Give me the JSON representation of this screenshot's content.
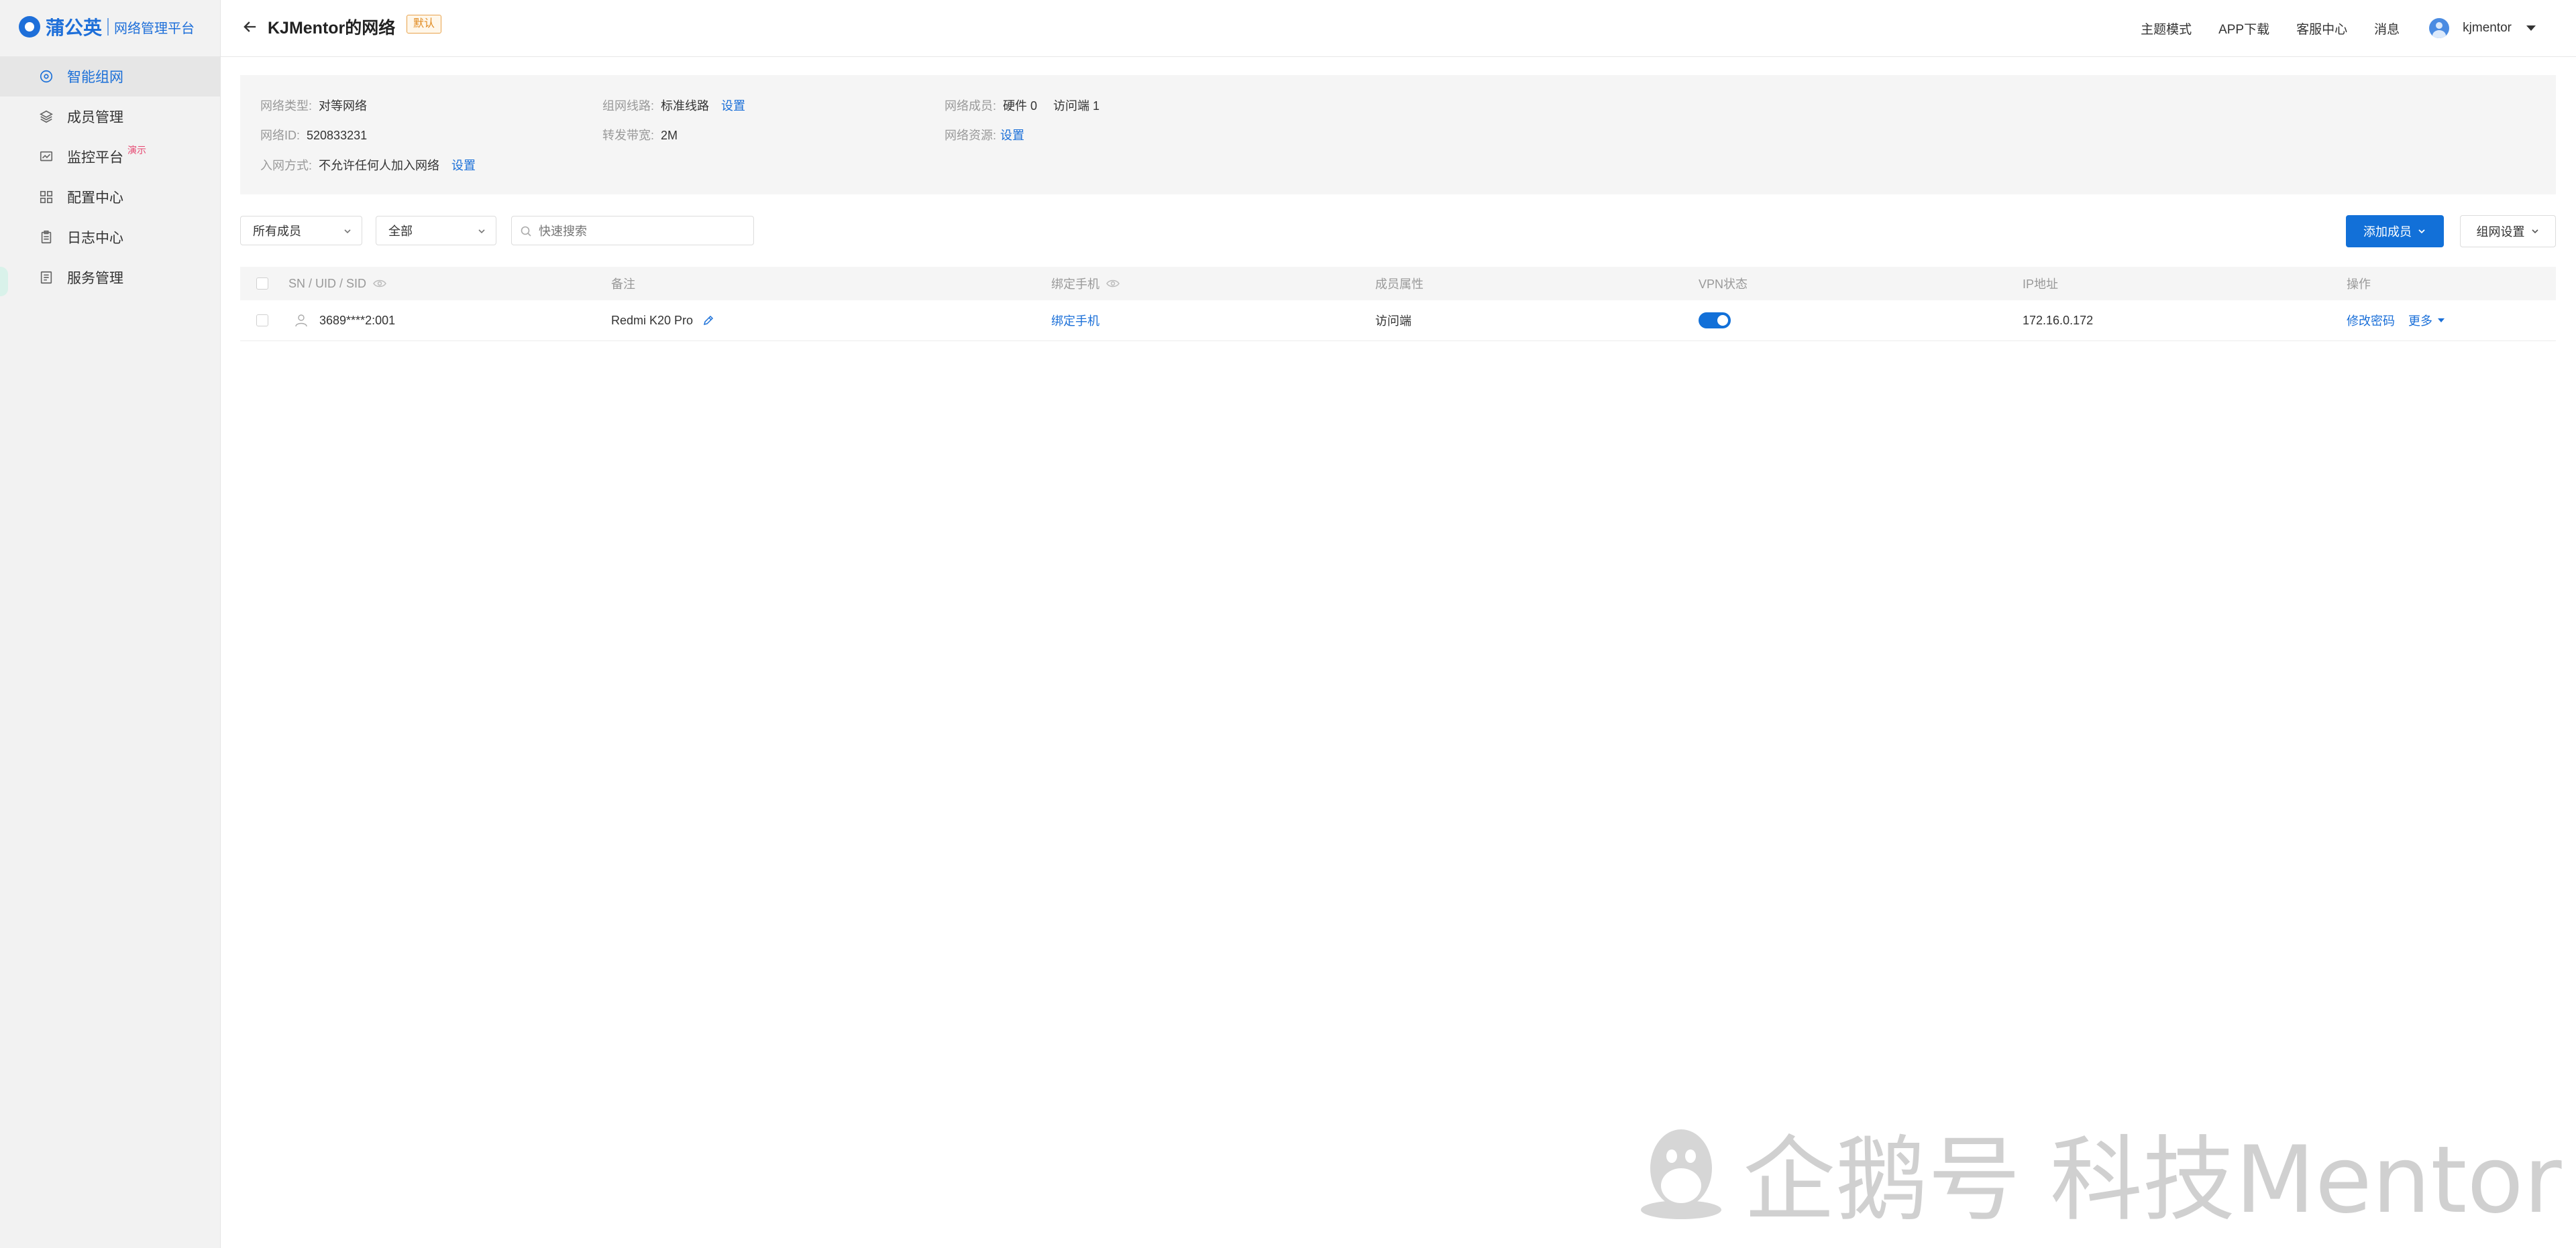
{
  "brand": {
    "name": "蒲公英",
    "subtitle": "网络管理平台",
    "color": "#1e6fd9"
  },
  "sidebar": {
    "items": [
      {
        "label": "智能组网",
        "icon": "network-icon",
        "active": true
      },
      {
        "label": "成员管理",
        "icon": "layers-icon"
      },
      {
        "label": "监控平台",
        "icon": "monitor-icon",
        "badge": "演示"
      },
      {
        "label": "配置中心",
        "icon": "grid-icon"
      },
      {
        "label": "日志中心",
        "icon": "clipboard-icon"
      },
      {
        "label": "服务管理",
        "icon": "document-icon"
      }
    ]
  },
  "header": {
    "title": "KJMentor的网络",
    "tag": "默认",
    "links": [
      "主题模式",
      "APP下载",
      "客服中心",
      "消息"
    ],
    "user": "kjmentor"
  },
  "info": {
    "network_type": {
      "key": "网络类型:",
      "value": "对等网络"
    },
    "network_line": {
      "key": "组网线路:",
      "value": "标准线路",
      "action": "设置"
    },
    "members": {
      "key": "网络成员:",
      "value": "硬件 0",
      "value2": "访问端 1"
    },
    "network_id": {
      "key": "网络ID:",
      "value": "520833231"
    },
    "bandwidth": {
      "key": "转发带宽:",
      "value": "2M"
    },
    "resources": {
      "key": "网络资源:",
      "action": "设置"
    },
    "join_method": {
      "key": "入网方式:",
      "value": "不允许任何人加入网络",
      "action": "设置"
    }
  },
  "filters": {
    "member_select": "所有成员",
    "status_select": "全部",
    "search_placeholder": "快速搜索"
  },
  "buttons": {
    "add_member": "添加成员",
    "network_settings": "组网设置"
  },
  "table": {
    "headers": {
      "sn": "SN / UID / SID",
      "remark": "备注",
      "phone": "绑定手机",
      "attribute": "成员属性",
      "vpn": "VPN状态",
      "ip": "IP地址",
      "action": "操作"
    },
    "rows": [
      {
        "sn": "3689****2:001",
        "remark": "Redmi K20 Pro",
        "phone": "绑定手机",
        "attribute": "访问端",
        "vpn_on": true,
        "ip": "172.16.0.172",
        "action_primary": "修改密码",
        "action_more": "更多"
      }
    ]
  },
  "watermark": "企鹅号 科技Mentor",
  "colors": {
    "accent": "#1270d8",
    "tag": "#e08a20",
    "badge": "#e6456f"
  }
}
